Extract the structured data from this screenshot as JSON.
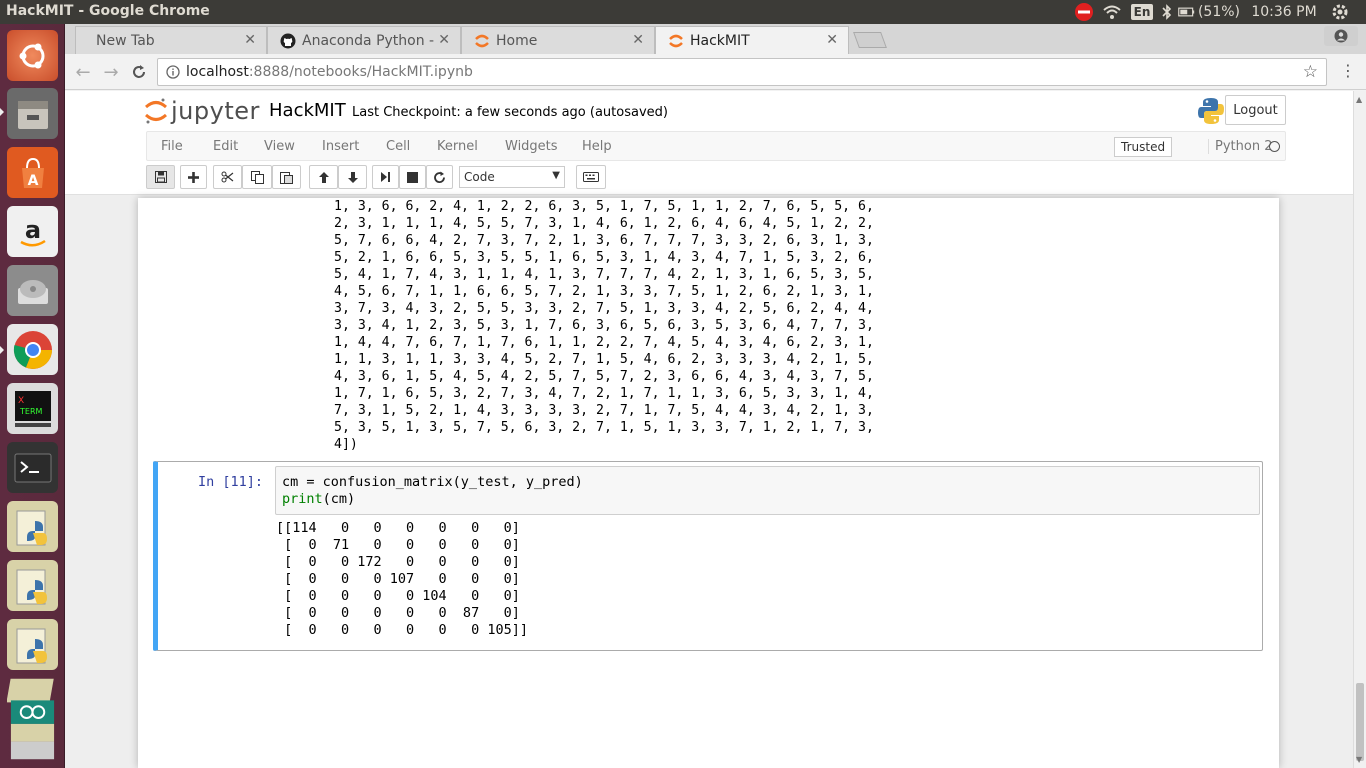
{
  "top_panel": {
    "window_title": "HackMIT - Google Chrome",
    "keyboard_layout": "En",
    "battery": "(51%)",
    "clock": "10:36 PM"
  },
  "launcher": {
    "items": [
      "ubuntu-dash",
      "files",
      "software-center",
      "amazon",
      "disk",
      "chrome",
      "xterm",
      "terminal",
      "python-notebook-1",
      "python-notebook-2",
      "python-notebook-3",
      "stacked-notebooks"
    ],
    "xterm_label": "X\nTERM"
  },
  "browser": {
    "tabs": [
      {
        "label": "New Tab",
        "active": false
      },
      {
        "label": "Anaconda Python -",
        "active": false
      },
      {
        "label": "Home",
        "active": false
      },
      {
        "label": "HackMIT",
        "active": true
      }
    ],
    "url_host": "localhost",
    "url_path": ":8888/notebooks/HackMIT.ipynb"
  },
  "jupyter": {
    "logo_text": "jupyter",
    "notebook_name": "HackMIT",
    "checkpoint": "Last Checkpoint: a few seconds ago (autosaved)",
    "logout_label": "Logout",
    "menu": [
      "File",
      "Edit",
      "View",
      "Insert",
      "Cell",
      "Kernel",
      "Widgets",
      "Help"
    ],
    "trusted_label": "Trusted",
    "kernel_name": "Python 2",
    "cell_type": "Code"
  },
  "notebook": {
    "prev_output": "1, 3, 6, 6, 2, 4, 1, 2, 2, 6, 3, 5, 1, 7, 5, 1, 1, 2, 7, 6, 5, 5, 6,\n2, 3, 1, 1, 1, 4, 5, 5, 7, 3, 1, 4, 6, 1, 2, 6, 4, 6, 4, 5, 1, 2, 2,\n5, 7, 6, 6, 4, 2, 7, 3, 7, 2, 1, 3, 6, 7, 7, 7, 3, 3, 2, 6, 3, 1, 3,\n5, 2, 1, 6, 6, 5, 3, 5, 5, 1, 6, 5, 3, 1, 4, 3, 4, 7, 1, 5, 3, 2, 6,\n5, 4, 1, 7, 4, 3, 1, 1, 4, 1, 3, 7, 7, 7, 4, 2, 1, 3, 1, 6, 5, 3, 5,\n4, 5, 6, 7, 1, 1, 6, 6, 5, 7, 2, 1, 3, 3, 7, 5, 1, 2, 6, 2, 1, 3, 1,\n3, 7, 3, 4, 3, 2, 5, 5, 3, 3, 2, 7, 5, 1, 3, 3, 4, 2, 5, 6, 2, 4, 4,\n3, 3, 4, 1, 2, 3, 5, 3, 1, 7, 6, 3, 6, 5, 6, 3, 5, 3, 6, 4, 7, 7, 3,\n1, 4, 4, 7, 6, 7, 1, 7, 6, 1, 1, 2, 2, 7, 4, 5, 4, 3, 4, 6, 2, 3, 1,\n1, 1, 3, 1, 1, 3, 3, 4, 5, 2, 7, 1, 5, 4, 6, 2, 3, 3, 3, 4, 2, 1, 5,\n4, 3, 6, 1, 5, 4, 5, 4, 2, 5, 7, 5, 7, 2, 3, 6, 6, 4, 3, 4, 3, 7, 5,\n1, 7, 1, 6, 5, 3, 2, 7, 3, 4, 7, 2, 1, 7, 1, 1, 3, 6, 5, 3, 3, 1, 4,\n7, 3, 1, 5, 2, 1, 4, 3, 3, 3, 3, 2, 7, 1, 7, 5, 4, 4, 3, 4, 2, 1, 3,\n5, 3, 5, 1, 3, 5, 7, 5, 6, 3, 2, 7, 1, 5, 1, 3, 3, 7, 1, 2, 1, 7, 3,\n4])",
    "cell_prompt": "In [11]:",
    "code_line1": "cm = confusion_matrix(y_test, y_pred)",
    "code_line2_fn": "print",
    "code_line2_rest": "(cm)",
    "cm_output": "[[114   0   0   0   0   0   0]\n [  0  71   0   0   0   0   0]\n [  0   0 172   0   0   0   0]\n [  0   0   0 107   0   0   0]\n [  0   0   0   0 104   0   0]\n [  0   0   0   0   0  87   0]\n [  0   0   0   0   0   0 105]]"
  },
  "colors": {
    "launcher_bg": "#5e2b40",
    "panel_bg": "#3c3b37",
    "jupyter_orange": "#f37726",
    "selected_cell_border": "#42a5f5",
    "prompt_blue": "#303f9f"
  }
}
